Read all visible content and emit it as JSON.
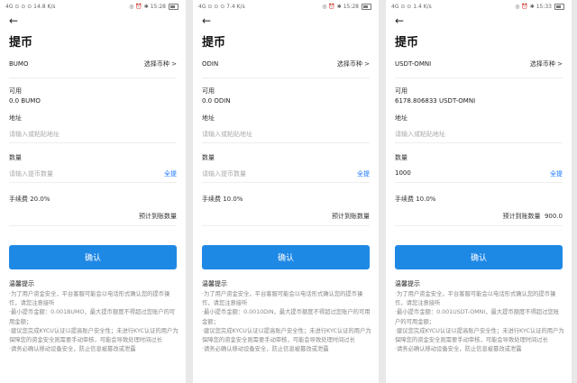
{
  "panels": [
    {
      "status": {
        "left": "4G ⊙ ⊙ ⊙ 14.8 K/s",
        "right": "◎ ⏰ ✱ 15:28"
      },
      "title": "提币",
      "coin": "BUMO",
      "select_label": "选择币种 >",
      "available_label": "可用",
      "available_value": "0.0 BUMO",
      "address_label": "地址",
      "address_placeholder": "请输入或粘贴地址",
      "amount_label": "数量",
      "amount_placeholder": "请输入提币数量",
      "amount_value": "",
      "all_label": "全提",
      "fee_text": "手续费  20.0%",
      "receive_label": "预计到账数量",
      "receive_value": "",
      "confirm_label": "确认",
      "tips_title": "温馨提示",
      "tips": [
        "·为了用户资金安全，平台客服可能会以电话形式确认您的提币操作，请您注意接听",
        "·最小提币金额：0.001BUMO，最大提币额度不得超过您账户的可用金额；",
        "·建议您完成KYCU认证以提高账户安全性；未进行KYC认证的用户为保障您的资金安全则需要手动审核，可能会导致处理时间过长",
        "·请务必确认移动设备安全，防止信息被篡改或泄露"
      ]
    },
    {
      "status": {
        "left": "4G ⊙ ⊙ ⊙ 7.4 K/s",
        "right": "◎ ⏰ ✱ 15:28"
      },
      "title": "提币",
      "coin": "ODIN",
      "select_label": "选择币种 >",
      "available_label": "可用",
      "available_value": "0.0 ODIN",
      "address_label": "地址",
      "address_placeholder": "请输入或粘贴地址",
      "amount_label": "数量",
      "amount_placeholder": "请输入提币数量",
      "amount_value": "",
      "all_label": "全提",
      "fee_text": "手续费  10.0%",
      "receive_label": "预计到账数量",
      "receive_value": "",
      "confirm_label": "确认",
      "tips_title": "温馨提示",
      "tips": [
        "·为了用户资金安全，平台客服可能会以电话形式确认您的提币操作，请您注意接听",
        "·最小提币金额：0.0010DIN，最大提币额度不得超过您账户的可用金额；",
        "·建议您完成KYCU认证以提高账户安全性；未进行KYC认证的用户为保障您的资金安全则需要手动审核，可能会导致处理时间过长",
        "·请务必确认移动设备安全，防止信息被篡改或泄露"
      ]
    },
    {
      "status": {
        "left": "4G ⊙ ⊙ 1.4 K/s",
        "right": "◎ ⏰ ✱ 15:33"
      },
      "title": "提币",
      "coin": "USDT-OMNI",
      "select_label": "选择币种 >",
      "available_label": "可用",
      "available_value": "6178.806833 USDT-OMNI",
      "address_label": "地址",
      "address_placeholder": "请输入或粘贴地址",
      "amount_label": "数量",
      "amount_placeholder": "",
      "amount_value": "1000",
      "all_label": "全提",
      "fee_text": "手续费  10.0%",
      "receive_label": "预计到账数量",
      "receive_value": "900.0",
      "confirm_label": "确认",
      "tips_title": "温馨提示",
      "tips": [
        "·为了用户资金安全，平台客服可能会以电话形式确认您的提币操作，请您注意接听",
        "·最小提币金额：0.001USDT-OMNI，最大提币额度不得超过您账户的可用金额；",
        "·建议您完成KYCU认证以提高账户安全性；未进行KYC认证的用户为保障您的资金安全则需要手动审核，可能会导致处理时间过长",
        "·请务必确认移动设备安全，防止信息被篡改或泄露"
      ]
    }
  ],
  "colors": {
    "accent": "#1e88e5",
    "link": "#1677ff",
    "placeholder": "#aaaaaa"
  }
}
